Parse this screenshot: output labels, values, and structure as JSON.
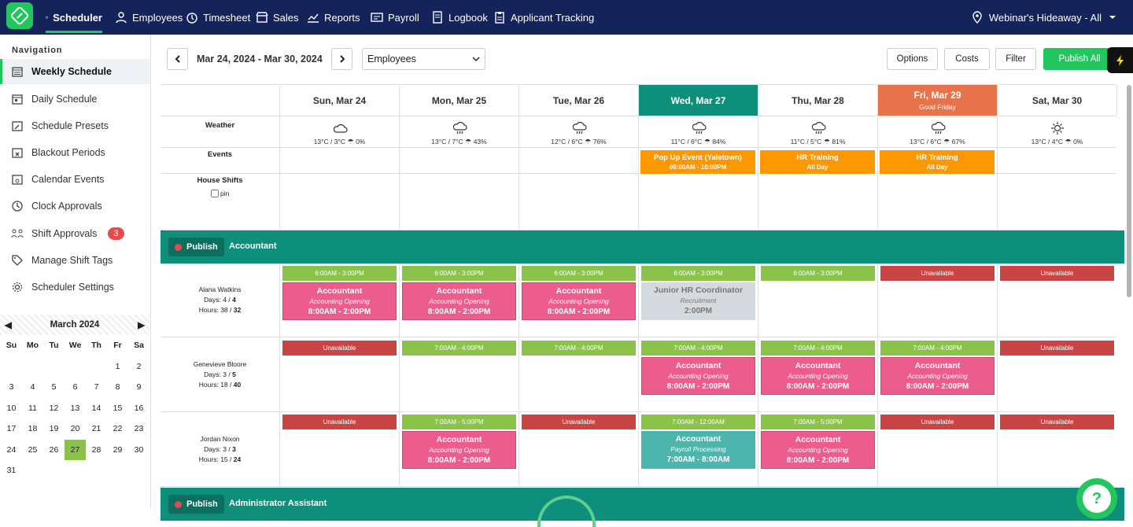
{
  "nav": {
    "items": [
      "Scheduler",
      "Employees",
      "Timesheet",
      "Sales",
      "Reports",
      "Payroll",
      "Logbook",
      "Applicant Tracking"
    ],
    "location": "Webinar's Hideaway - All"
  },
  "sidebar": {
    "title": "Navigation",
    "items": [
      "Weekly Schedule",
      "Daily Schedule",
      "Schedule Presets",
      "Blackout Periods",
      "Calendar Events",
      "Clock Approvals",
      "Shift Approvals",
      "Manage Shift Tags",
      "Scheduler Settings"
    ],
    "shift_approvals_badge": "3"
  },
  "calendar": {
    "month": "March 2024",
    "dows": [
      "Su",
      "Mo",
      "Tu",
      "We",
      "Th",
      "Fr",
      "Sa"
    ],
    "today": "27"
  },
  "toolbar": {
    "range": "Mar 24, 2024 - Mar 30, 2024",
    "view": "Employees",
    "options": "Options",
    "costs": "Costs",
    "filter": "Filter",
    "publish_all": "Publish All"
  },
  "days": [
    {
      "label": "Sun, Mar 24",
      "sub": "",
      "temp": "13°C / 3°C",
      "rain": "0%",
      "icon": "cloud"
    },
    {
      "label": "Mon, Mar 25",
      "sub": "",
      "temp": "13°C / 7°C",
      "rain": "43%",
      "icon": "rain"
    },
    {
      "label": "Tue, Mar 26",
      "sub": "",
      "temp": "12°C / 6°C",
      "rain": "76%",
      "icon": "rain"
    },
    {
      "label": "Wed, Mar 27",
      "sub": "",
      "temp": "11°C / 6°C",
      "rain": "84%",
      "icon": "rain"
    },
    {
      "label": "Thu, Mar 28",
      "sub": "",
      "temp": "11°C / 5°C",
      "rain": "81%",
      "icon": "rain"
    },
    {
      "label": "Fri, Mar 29",
      "sub": "Good Friday",
      "temp": "13°C / 6°C",
      "rain": "67%",
      "icon": "rain"
    },
    {
      "label": "Sat, Mar 30",
      "sub": "",
      "temp": "13°C / 4°C",
      "rain": "0%",
      "icon": "sun"
    }
  ],
  "row_labels": {
    "weather": "Weather",
    "events": "Events",
    "house": "House Shifts",
    "pin": "pin"
  },
  "events": [
    {
      "day": 3,
      "title": "Pop Up Event (Yaletown)",
      "sub": "06:00AM - 10:00PM"
    },
    {
      "day": 4,
      "title": "HR Training",
      "sub": "All Day"
    },
    {
      "day": 5,
      "title": "HR Training",
      "sub": "All Day"
    }
  ],
  "departments": [
    {
      "publish": "Publish",
      "name": "Accountant"
    },
    {
      "publish": "Publish",
      "name": "Administrator Assistant"
    }
  ],
  "employees": [
    {
      "name": "Alana Watkins",
      "days": "Days: 4 / ",
      "days_max": "4",
      "hours": "Hours: 38 / ",
      "hours_max": "32",
      "cells": [
        {
          "avail": "6:00AM - 3:00PM",
          "a": "g",
          "shift": {
            "t": "Accountant",
            "s": "Accounting Opening",
            "h": "8:00AM - 2:00PM",
            "c": "pink"
          }
        },
        {
          "avail": "6:00AM - 3:00PM",
          "a": "g",
          "shift": {
            "t": "Accountant",
            "s": "Accounting Opening",
            "h": "8:00AM - 2:00PM",
            "c": "pink"
          }
        },
        {
          "avail": "6:00AM - 3:00PM",
          "a": "g",
          "shift": {
            "t": "Accountant",
            "s": "Accounting Opening",
            "h": "8:00AM - 2:00PM",
            "c": "pink"
          }
        },
        {
          "avail": "6:00AM - 3:00PM",
          "a": "g",
          "shift": {
            "t": "Junior HR Coordinator",
            "s": "Recruitment",
            "h": "2:00PM",
            "c": "gray"
          }
        },
        {
          "avail": "6:00AM - 3:00PM",
          "a": "g",
          "shift": null
        },
        {
          "avail": "Unavailable",
          "a": "r",
          "shift": null
        },
        {
          "avail": "Unavailable",
          "a": "r",
          "shift": null
        }
      ]
    },
    {
      "name": "Genevieve Bloore",
      "days": "Days: 3 / ",
      "days_max": "5",
      "hours": "Hours: 18 / ",
      "hours_max": "40",
      "cells": [
        {
          "avail": "Unavailable",
          "a": "r",
          "shift": null
        },
        {
          "avail": "7:00AM - 4:00PM",
          "a": "g",
          "shift": null
        },
        {
          "avail": "7:00AM - 4:00PM",
          "a": "g",
          "shift": null
        },
        {
          "avail": "7:00AM - 4:00PM",
          "a": "g",
          "shift": {
            "t": "Accountant",
            "s": "Accounting Opening",
            "h": "8:00AM - 2:00PM",
            "c": "pink"
          }
        },
        {
          "avail": "7:00AM - 4:00PM",
          "a": "g",
          "shift": {
            "t": "Accountant",
            "s": "Accounting Opening",
            "h": "8:00AM - 2:00PM",
            "c": "pink"
          }
        },
        {
          "avail": "7:00AM - 4:00PM",
          "a": "g",
          "shift": {
            "t": "Accountant",
            "s": "Accounting Opening",
            "h": "8:00AM - 2:00PM",
            "c": "pink"
          }
        },
        {
          "avail": "Unavailable",
          "a": "r",
          "shift": null
        }
      ]
    },
    {
      "name": "Jordan Nixon",
      "days": "Days: 3 / ",
      "days_max": "3",
      "hours": "Hours: 15 / ",
      "hours_max": "24",
      "cells": [
        {
          "avail": "Unavailable",
          "a": "r",
          "shift": null
        },
        {
          "avail": "7:00AM - 5:00PM",
          "a": "g",
          "shift": {
            "t": "Accountant",
            "s": "Accounting Opening",
            "h": "8:00AM - 2:00PM",
            "c": "pink"
          }
        },
        {
          "avail": "Unavailable",
          "a": "r",
          "shift": null
        },
        {
          "avail": "7:00AM - 12:00AM",
          "a": "g",
          "shift": {
            "t": "Accountant",
            "s": "Payroll Processing",
            "h": "7:00AM - 8:00AM",
            "c": "teal"
          }
        },
        {
          "avail": "7:00AM - 5:00PM",
          "a": "g",
          "shift": {
            "t": "Accountant",
            "s": "Accounting Opening",
            "h": "8:00AM - 2:00PM",
            "c": "pink"
          }
        },
        {
          "avail": "Unavailable",
          "a": "r",
          "shift": null
        },
        {
          "avail": "Unavailable",
          "a": "r",
          "shift": null
        }
      ]
    }
  ],
  "colors": {
    "nav_bg": "#14245a",
    "accent": "#22c55e",
    "dept_bar": "#0e8f7b",
    "today": "#0e8f7b",
    "holiday": "#e8734a",
    "event": "#ff9800",
    "shift_pink": "#ec5c8c",
    "avail_green": "#8bc34a",
    "unavail_red": "#c94545"
  }
}
